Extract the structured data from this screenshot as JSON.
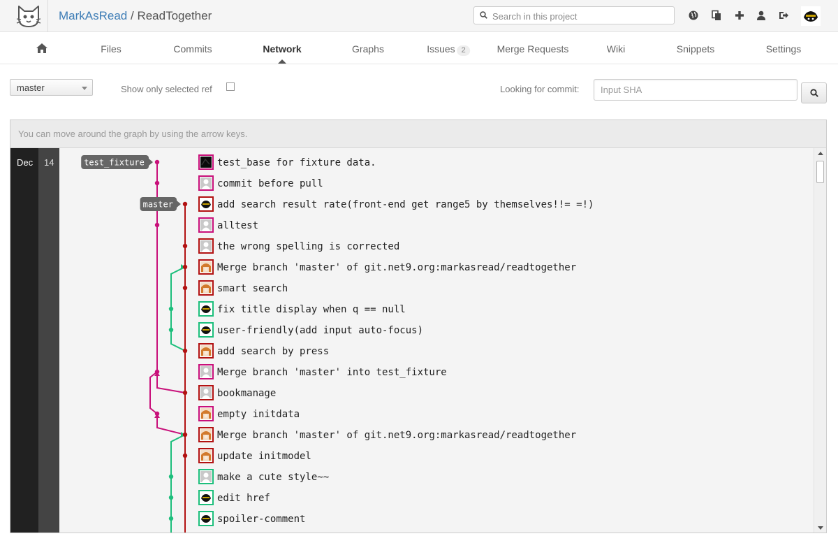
{
  "header": {
    "namespace": "MarkAsRead",
    "separator": " / ",
    "project": "ReadTogether",
    "search_placeholder": "Search in this project",
    "icons": [
      "globe-icon",
      "copy-icon",
      "plus-icon",
      "user-icon",
      "sign-out-icon"
    ]
  },
  "nav": {
    "items": [
      {
        "id": "home",
        "label": "",
        "icon": "home-icon"
      },
      {
        "id": "files",
        "label": "Files"
      },
      {
        "id": "commits",
        "label": "Commits"
      },
      {
        "id": "network",
        "label": "Network",
        "active": true
      },
      {
        "id": "graphs",
        "label": "Graphs"
      },
      {
        "id": "issues",
        "label": "Issues",
        "count": "2"
      },
      {
        "id": "merge_requests",
        "label": "Merge Requests"
      },
      {
        "id": "wiki",
        "label": "Wiki"
      },
      {
        "id": "snippets",
        "label": "Snippets"
      },
      {
        "id": "settings",
        "label": "Settings"
      }
    ]
  },
  "filters": {
    "ref": "master",
    "only_selected_label": "Show only selected ref",
    "only_selected_checked": false,
    "looking_label": "Looking for commit:",
    "sha_placeholder": "Input SHA"
  },
  "graph": {
    "hint": "You can move around the graph by using the arrow keys.",
    "month": "Dec",
    "day": "14",
    "refs": [
      {
        "name": "test_fixture",
        "row": 0,
        "lane": 0
      },
      {
        "name": "master",
        "row": 2,
        "lane": 1
      }
    ],
    "colors": {
      "magenta": "#c8107a",
      "red": "#b21212",
      "green": "#1dbf7c"
    },
    "commits": [
      {
        "message": "test_base for fixture data.",
        "lane": 0,
        "avatar": "dark"
      },
      {
        "message": "commit before pull",
        "lane": 0,
        "avatar": "default"
      },
      {
        "message": "add search result rate(front-end get range5 by themselves!!= =!)",
        "lane": 1,
        "avatar": "cat"
      },
      {
        "message": "alltest",
        "lane": 0,
        "avatar": "default"
      },
      {
        "message": "the wrong spelling is corrected",
        "lane": 1,
        "avatar": "default"
      },
      {
        "message": "Merge branch 'master' of git.net9.org:markasread/readtogether",
        "lane": 1,
        "avatar": "girl"
      },
      {
        "message": "smart search",
        "lane": 1,
        "avatar": "girl"
      },
      {
        "message": "fix title display when q == null",
        "lane": 2,
        "avatar": "cat"
      },
      {
        "message": "user-friendly(add input auto-focus)",
        "lane": 2,
        "avatar": "cat"
      },
      {
        "message": "add search by press",
        "lane": 1,
        "avatar": "girl"
      },
      {
        "message": "Merge branch 'master' into test_fixture",
        "lane": 0,
        "avatar": "default"
      },
      {
        "message": "bookmanage",
        "lane": 1,
        "avatar": "default"
      },
      {
        "message": "empty initdata",
        "lane": 0,
        "avatar": "girl"
      },
      {
        "message": "Merge branch 'master' of git.net9.org:markasread/readtogether",
        "lane": 1,
        "avatar": "girl"
      },
      {
        "message": "update initmodel",
        "lane": 1,
        "avatar": "girl"
      },
      {
        "message": "make a cute style~~",
        "lane": 2,
        "avatar": "default"
      },
      {
        "message": "edit href",
        "lane": 2,
        "avatar": "cat"
      },
      {
        "message": "spoiler-comment",
        "lane": 2,
        "avatar": "cat"
      }
    ]
  }
}
